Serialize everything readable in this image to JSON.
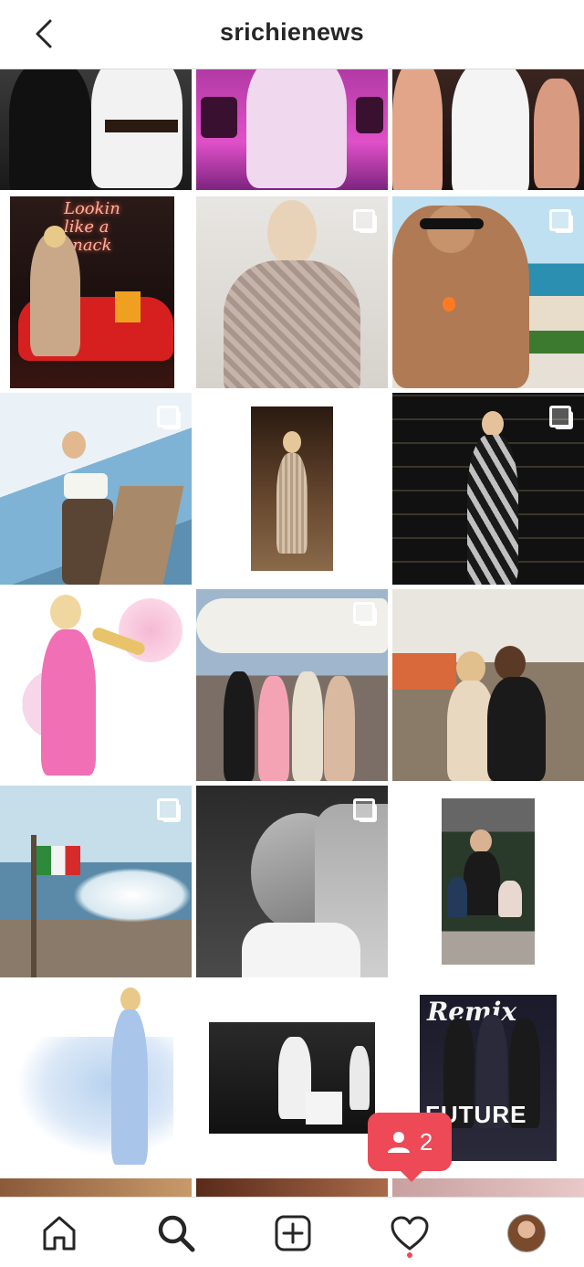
{
  "header": {
    "title": "srichienews",
    "back_icon": "chevron-left-icon"
  },
  "posts": [
    {
      "id": "p1",
      "multi": false
    },
    {
      "id": "p2",
      "multi": false
    },
    {
      "id": "p3",
      "multi": false
    },
    {
      "id": "p4",
      "multi": false
    },
    {
      "id": "p5",
      "multi": true
    },
    {
      "id": "p6",
      "multi": true
    },
    {
      "id": "p7",
      "multi": true
    },
    {
      "id": "p8",
      "multi": false
    },
    {
      "id": "p9",
      "multi": true
    },
    {
      "id": "p10",
      "multi": false
    },
    {
      "id": "p11",
      "multi": true
    },
    {
      "id": "p12",
      "multi": false
    },
    {
      "id": "p13",
      "multi": true
    },
    {
      "id": "p14",
      "multi": true
    },
    {
      "id": "p15",
      "multi": false
    },
    {
      "id": "p16",
      "multi": false
    },
    {
      "id": "p17",
      "multi": true
    },
    {
      "id": "p18",
      "multi": false
    }
  ],
  "notification": {
    "icon": "person-icon",
    "count": "2",
    "color": "#ed4956"
  },
  "bottom_nav": {
    "items": [
      {
        "name": "home",
        "icon": "home-icon"
      },
      {
        "name": "search",
        "icon": "search-icon",
        "active": true
      },
      {
        "name": "new-post",
        "icon": "add-post-icon"
      },
      {
        "name": "activity",
        "icon": "heart-icon",
        "has_dot": true
      },
      {
        "name": "profile",
        "icon": "avatar"
      }
    ]
  }
}
